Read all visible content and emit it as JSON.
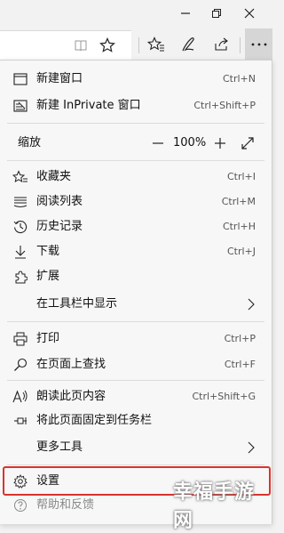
{
  "menu": {
    "new_window": {
      "label": "新建窗口",
      "shortcut": "Ctrl+N",
      "icon": "new-window-icon"
    },
    "new_inprivate": {
      "label": "新建 InPrivate 窗口",
      "shortcut": "Ctrl+Shift+P",
      "icon": "inprivate-icon"
    },
    "zoom": {
      "label": "缩放",
      "value": "100%",
      "minus": "—",
      "plus": "+"
    },
    "favorites": {
      "label": "收藏夹",
      "shortcut": "Ctrl+I",
      "icon": "favorites-icon"
    },
    "reading_list": {
      "label": "阅读列表",
      "shortcut": "Ctrl+M",
      "icon": "reading-list-icon"
    },
    "history": {
      "label": "历史记录",
      "shortcut": "Ctrl+H",
      "icon": "history-icon"
    },
    "downloads": {
      "label": "下载",
      "shortcut": "Ctrl+J",
      "icon": "download-icon"
    },
    "extensions": {
      "label": "扩展",
      "icon": "extensions-icon"
    },
    "show_in_toolbar": {
      "label": "在工具栏中显示"
    },
    "print": {
      "label": "打印",
      "shortcut": "Ctrl+P",
      "icon": "print-icon"
    },
    "find": {
      "label": "在页面上查找",
      "shortcut": "Ctrl+F",
      "icon": "search-icon"
    },
    "read_aloud": {
      "label": "朗读此页内容",
      "shortcut": "Ctrl+Shift+G",
      "icon": "read-aloud-icon"
    },
    "pin_taskbar": {
      "label": "将此页面固定到任务栏",
      "icon": "pin-icon"
    },
    "more_tools": {
      "label": "更多工具"
    },
    "settings": {
      "label": "设置",
      "icon": "gear-icon"
    },
    "help": {
      "label": "帮助和反馈",
      "icon": "help-icon"
    }
  },
  "watermark": "幸福手游网",
  "colors": {
    "highlight": "#d8342e",
    "menu_bg": "#f7f7f7",
    "chrome_bg": "#f2f2f2"
  }
}
